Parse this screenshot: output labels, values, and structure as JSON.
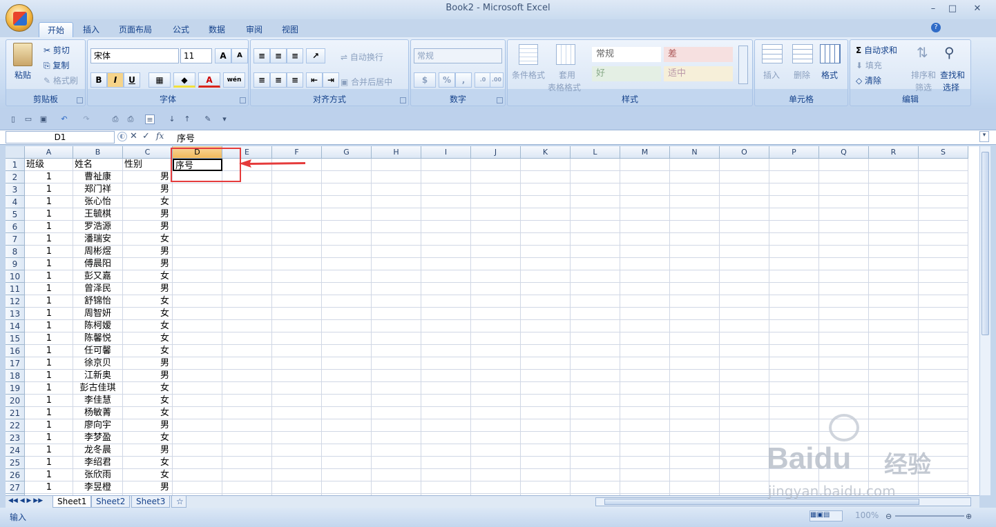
{
  "window": {
    "title": "Book2 - Microsoft Excel"
  },
  "tabs": [
    "开始",
    "插入",
    "页面布局",
    "公式",
    "数据",
    "审阅",
    "视图"
  ],
  "ribbon": {
    "clipboard": {
      "label": "剪贴板",
      "paste": "粘贴",
      "cut": "剪切",
      "copy": "复制",
      "format_painter": "格式刷"
    },
    "font": {
      "label": "字体",
      "font_name": "宋体",
      "font_size": "11",
      "bold": "B",
      "italic": "I",
      "underline": "U"
    },
    "alignment": {
      "label": "对齐方式",
      "wrap": "自动换行",
      "merge": "合并后居中"
    },
    "number": {
      "label": "数字",
      "format": "常规"
    },
    "styles": {
      "label": "样式",
      "conditional": "条件格式",
      "table_fmt_1": "套用",
      "table_fmt_2": "表格格式",
      "normal": "常规",
      "bad": "差",
      "good": "好",
      "neutral": "适中"
    },
    "cells": {
      "label": "单元格",
      "insert": "插入",
      "delete": "删除",
      "format": "格式"
    },
    "editing": {
      "label": "编辑",
      "autosum": "自动求和",
      "fill": "填充",
      "clear": "清除",
      "sort": "排序和",
      "sort2": "筛选",
      "find": "查找和",
      "find2": "选择"
    }
  },
  "formula_bar": {
    "name_box": "D1",
    "fx": "fx",
    "value": "序号"
  },
  "grid": {
    "columns": [
      "A",
      "B",
      "C",
      "D",
      "E",
      "F",
      "G",
      "H",
      "I",
      "J",
      "K",
      "L",
      "M",
      "N",
      "O",
      "P",
      "Q",
      "R",
      "S"
    ],
    "header_row": [
      "班级",
      "姓名",
      "性别",
      "序号"
    ],
    "rows": [
      [
        "1",
        "曹祉康",
        "男"
      ],
      [
        "1",
        "郑门祥",
        "男"
      ],
      [
        "1",
        "张心怡",
        "女"
      ],
      [
        "1",
        "王毓棋",
        "男"
      ],
      [
        "1",
        "罗浩源",
        "男"
      ],
      [
        "1",
        "潘瑞安",
        "女"
      ],
      [
        "1",
        "周彬煜",
        "男"
      ],
      [
        "1",
        "傅晨阳",
        "男"
      ],
      [
        "1",
        "彭又嘉",
        "女"
      ],
      [
        "1",
        "曾泽民",
        "男"
      ],
      [
        "1",
        "舒锦怡",
        "女"
      ],
      [
        "1",
        "周智妍",
        "女"
      ],
      [
        "1",
        "陈柯嫒",
        "女"
      ],
      [
        "1",
        "陈馨悦",
        "女"
      ],
      [
        "1",
        "任可馨",
        "女"
      ],
      [
        "1",
        "徐京贝",
        "男"
      ],
      [
        "1",
        "江新奥",
        "男"
      ],
      [
        "1",
        "彭古佳琪",
        "女"
      ],
      [
        "1",
        "李佳慧",
        "女"
      ],
      [
        "1",
        "杨敏菁",
        "女"
      ],
      [
        "1",
        "廖向宇",
        "男"
      ],
      [
        "1",
        "李梦盈",
        "女"
      ],
      [
        "1",
        "龙冬晨",
        "男"
      ],
      [
        "1",
        "李绍君",
        "女"
      ],
      [
        "1",
        "张欣雨",
        "女"
      ],
      [
        "1",
        "李昱橙",
        "男"
      ]
    ]
  },
  "sheets": [
    "Sheet1",
    "Sheet2",
    "Sheet3"
  ],
  "status": {
    "mode": "输入",
    "zoom": "100%"
  },
  "watermark": {
    "brand": "Baidu",
    "brand_cn": "经验",
    "url": "jingyan.baidu.com"
  },
  "colors": {
    "accent": "#15428b",
    "highlight": "#e53b3b",
    "selected_header": "#f1b95b"
  }
}
